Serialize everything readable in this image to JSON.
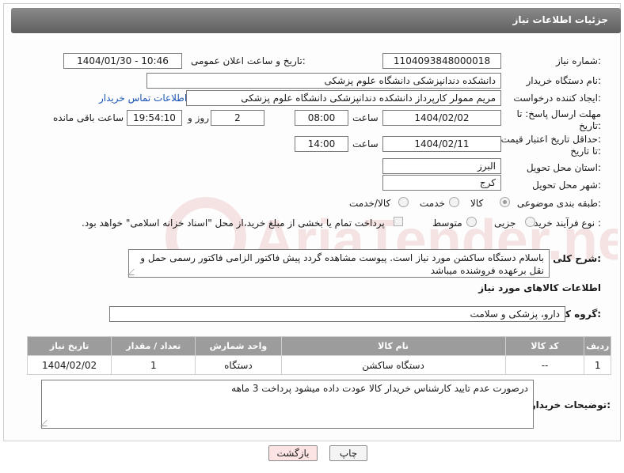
{
  "header": {
    "title": "جزئیات اطلاعات نیاز"
  },
  "fields": {
    "need_number_label": "شماره نیاز:",
    "need_number_value": "1104093848000018",
    "announce_label": "تاریخ و ساعت اعلان عمومی:",
    "announce_value": "1404/01/30 - 10:46",
    "buyer_org_label": "نام دستگاه خریدار:",
    "buyer_org_value": "دانشکده دندانپزشکی دانشگاه علوم پزشکی",
    "creator_label": "ایجاد کننده درخواست:",
    "creator_value": "مریم ممولر کارپرداز دانشکده دندانپزشکی دانشگاه علوم پزشکی",
    "contact_link": "اطلاعات تماس خریدار",
    "deadline_label_1": "مهلت ارسال پاسخ: تا",
    "deadline_label_2": "تاریخ:",
    "deadline_date": "1404/02/02",
    "time_label": "ساعت",
    "deadline_time": "08:00",
    "days_value": "2",
    "days_label": "روز و",
    "remaining_time": "19:54:10",
    "remaining_label": "ساعت باقی مانده",
    "price_label_1": "حداقل تاریخ اعتبار قیمت:",
    "price_label_2": "تا تاریخ:",
    "price_date": "1404/02/11",
    "price_time_label": "ساعت",
    "price_time": "14:00",
    "province_label": "استان محل تحویل:",
    "province_value": "البرز",
    "city_label": "شهر محل تحویل:",
    "city_value": "کرج",
    "category_label": "طبقه بندی موضوعی:",
    "category_options": [
      "کالا",
      "خدمت",
      "کالا/خدمت"
    ],
    "process_label": "نوع فرآیند خرید :",
    "process_options": [
      "جزیی",
      "متوسط"
    ],
    "process_note": "پرداخت تمام یا بخشی از مبلغ خرید،از محل \"اسناد خزانه اسلامی\" خواهد بود.",
    "description_label": "شرح کلی نیاز:",
    "description_value": "باسلام  دستگاه ساکشن مورد نیاز است. پیوست مشاهده گردد پیش فاکتور الزامی فاکتور رسمی حمل و نقل برعهده فروشنده میباشد"
  },
  "goods": {
    "section_title": "اطلاعات کالاهای مورد نیاز",
    "group_label": "گروه کالا:",
    "group_value": "دارو، پزشکی و سلامت",
    "columns": [
      "ردیف",
      "کد کالا",
      "نام کالا",
      "واحد شمارش",
      "تعداد / مقدار",
      "تاریخ نیاز"
    ],
    "rows": [
      [
        "1",
        "--",
        "دستگاه ساکشن",
        "دستگاه",
        "1",
        "1404/02/02"
      ]
    ]
  },
  "buyer_notes": {
    "label": "توضیحات خریدار:",
    "value": "درصورت عدم تایید کارشناس خریدار کالا عودت داده میشود پرداخت 3 ماهه"
  },
  "buttons": {
    "print": "چاپ",
    "back": "بازگشت"
  },
  "watermark": {
    "text": "AriaTender.neT"
  },
  "colors": {
    "header_bg": "#6e6e6e",
    "table_header_bg": "#9c9c9c",
    "link": "#1a55b4",
    "back_button_bg": "#fde4e4",
    "watermark": "#c23a3a"
  }
}
